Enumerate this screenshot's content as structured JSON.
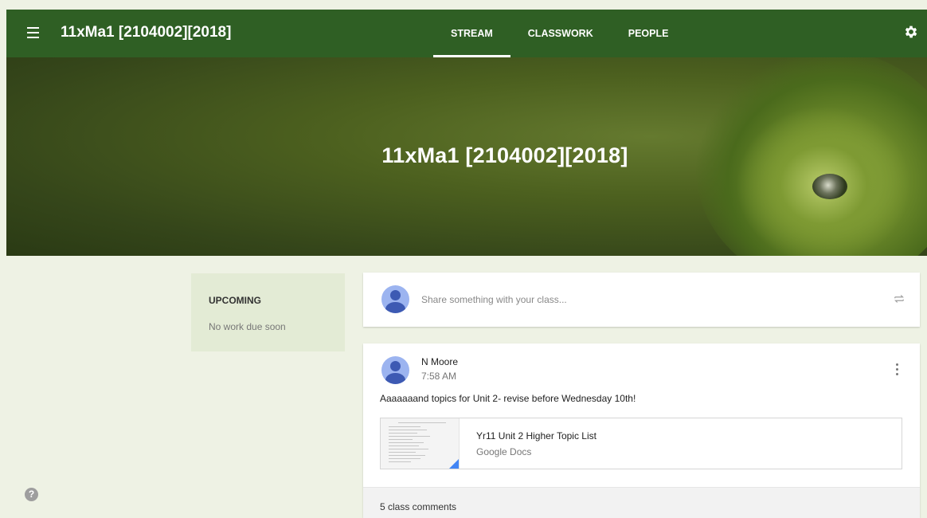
{
  "header": {
    "title": "11xMa1 [2104002][2018]",
    "tabs": [
      {
        "label": "STREAM",
        "active": true
      },
      {
        "label": "CLASSWORK",
        "active": false
      },
      {
        "label": "PEOPLE",
        "active": false
      }
    ],
    "menu_icon": "hamburger-menu-icon",
    "settings_icon": "gear-icon",
    "bar_color": "#2f5f24"
  },
  "banner": {
    "title": "11xMa1 [2104002][2018]"
  },
  "upcoming": {
    "title": "UPCOMING",
    "empty_text": "No work due soon"
  },
  "share": {
    "placeholder": "Share something with your class...",
    "repost_icon": "repost-icon"
  },
  "post": {
    "author": "N Moore",
    "time": "7:58 AM",
    "body": "Aaaaaaand topics for Unit 2- revise before Wednesday 10th!",
    "attachment": {
      "title": "Yr11 Unit 2 Higher Topic List",
      "type": "Google Docs"
    },
    "comments_label": "5 class comments"
  },
  "help": {
    "icon": "help-icon",
    "glyph": "?"
  }
}
